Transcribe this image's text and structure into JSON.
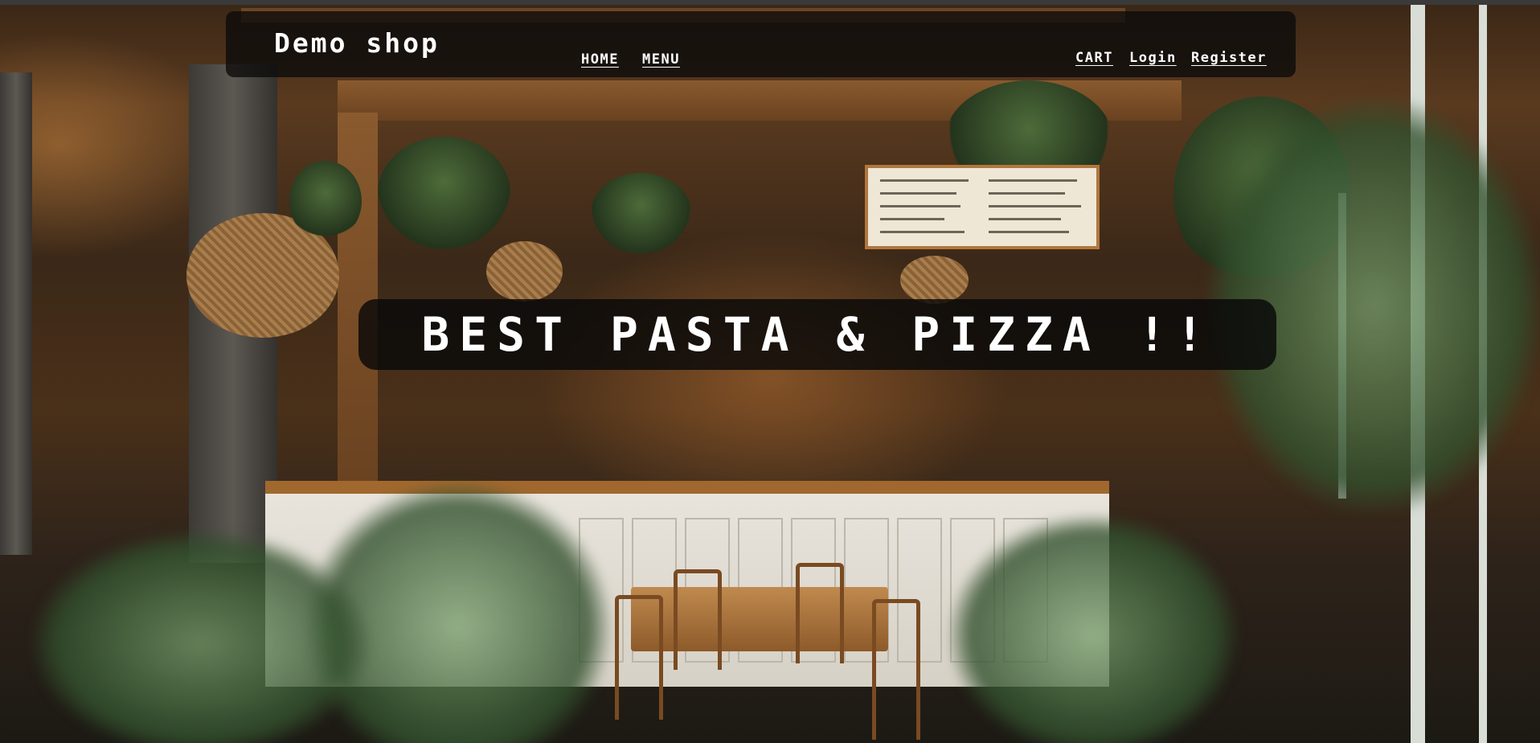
{
  "navbar": {
    "brand": "Demo shop",
    "links_left": [
      {
        "label": "HOME"
      },
      {
        "label": "MENU"
      }
    ],
    "links_right": [
      {
        "label": "CART"
      },
      {
        "label": "Login"
      },
      {
        "label": "Register"
      }
    ]
  },
  "hero": {
    "title": "BEST PASTA & PIZZA !!"
  },
  "colors": {
    "navbar_bg": "#0a0a0a",
    "text": "#ffffff",
    "banner_bg": "#080808"
  },
  "icons": [
    "restaurant-background-image"
  ]
}
